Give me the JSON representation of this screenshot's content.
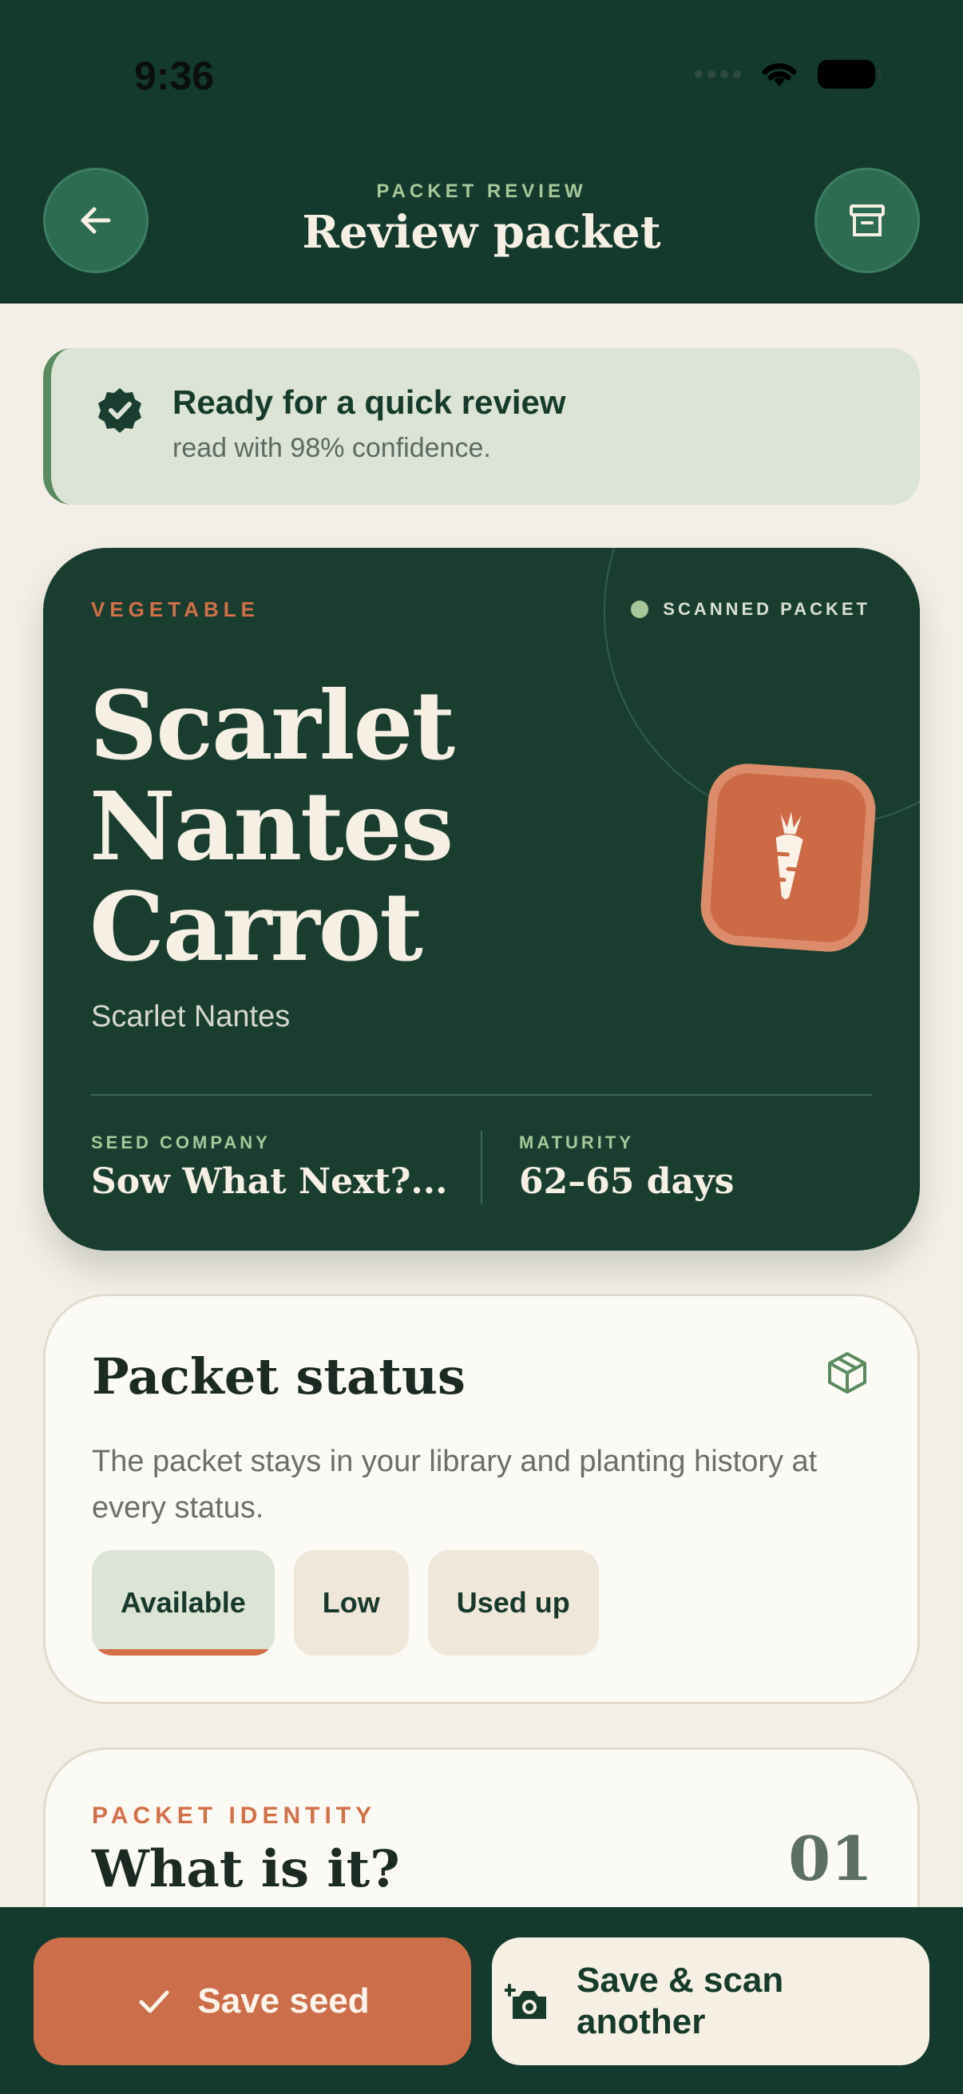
{
  "status_bar": {
    "time": "9:36"
  },
  "header": {
    "eyebrow": "PACKET REVIEW",
    "title": "Review packet",
    "back_icon": "arrow-left-icon",
    "archive_icon": "archive-box-icon"
  },
  "banner": {
    "title": "Ready for a quick review",
    "subtitle": "read with 98% confidence.",
    "icon": "verified-badge-icon"
  },
  "hero": {
    "type": "VEGETABLE",
    "source_label": "SCANNED PACKET",
    "name": "Scarlet Nantes Carrot",
    "variety": "Scarlet Nantes",
    "badge_icon": "carrot-icon",
    "seed_company_label": "SEED COMPANY",
    "seed_company": "Sow What Next?...",
    "maturity_label": "MATURITY",
    "maturity": "62–65 days"
  },
  "status_card": {
    "title": "Packet status",
    "description": "The packet stays in your library and planting history at every status.",
    "icon": "package-icon",
    "options": [
      "Available",
      "Low",
      "Used up"
    ],
    "selected": "Available"
  },
  "identity_card": {
    "eyebrow": "PACKET IDENTITY",
    "title": "What is it?",
    "number": "01"
  },
  "actions": {
    "save_label": "Save seed",
    "save_scan_label": "Save & scan another"
  },
  "colors": {
    "forest": "#133a2c",
    "card_green": "#193e30",
    "terracotta": "#cc6e4a",
    "cream": "#f4efe6",
    "sage": "#dce4d6"
  }
}
